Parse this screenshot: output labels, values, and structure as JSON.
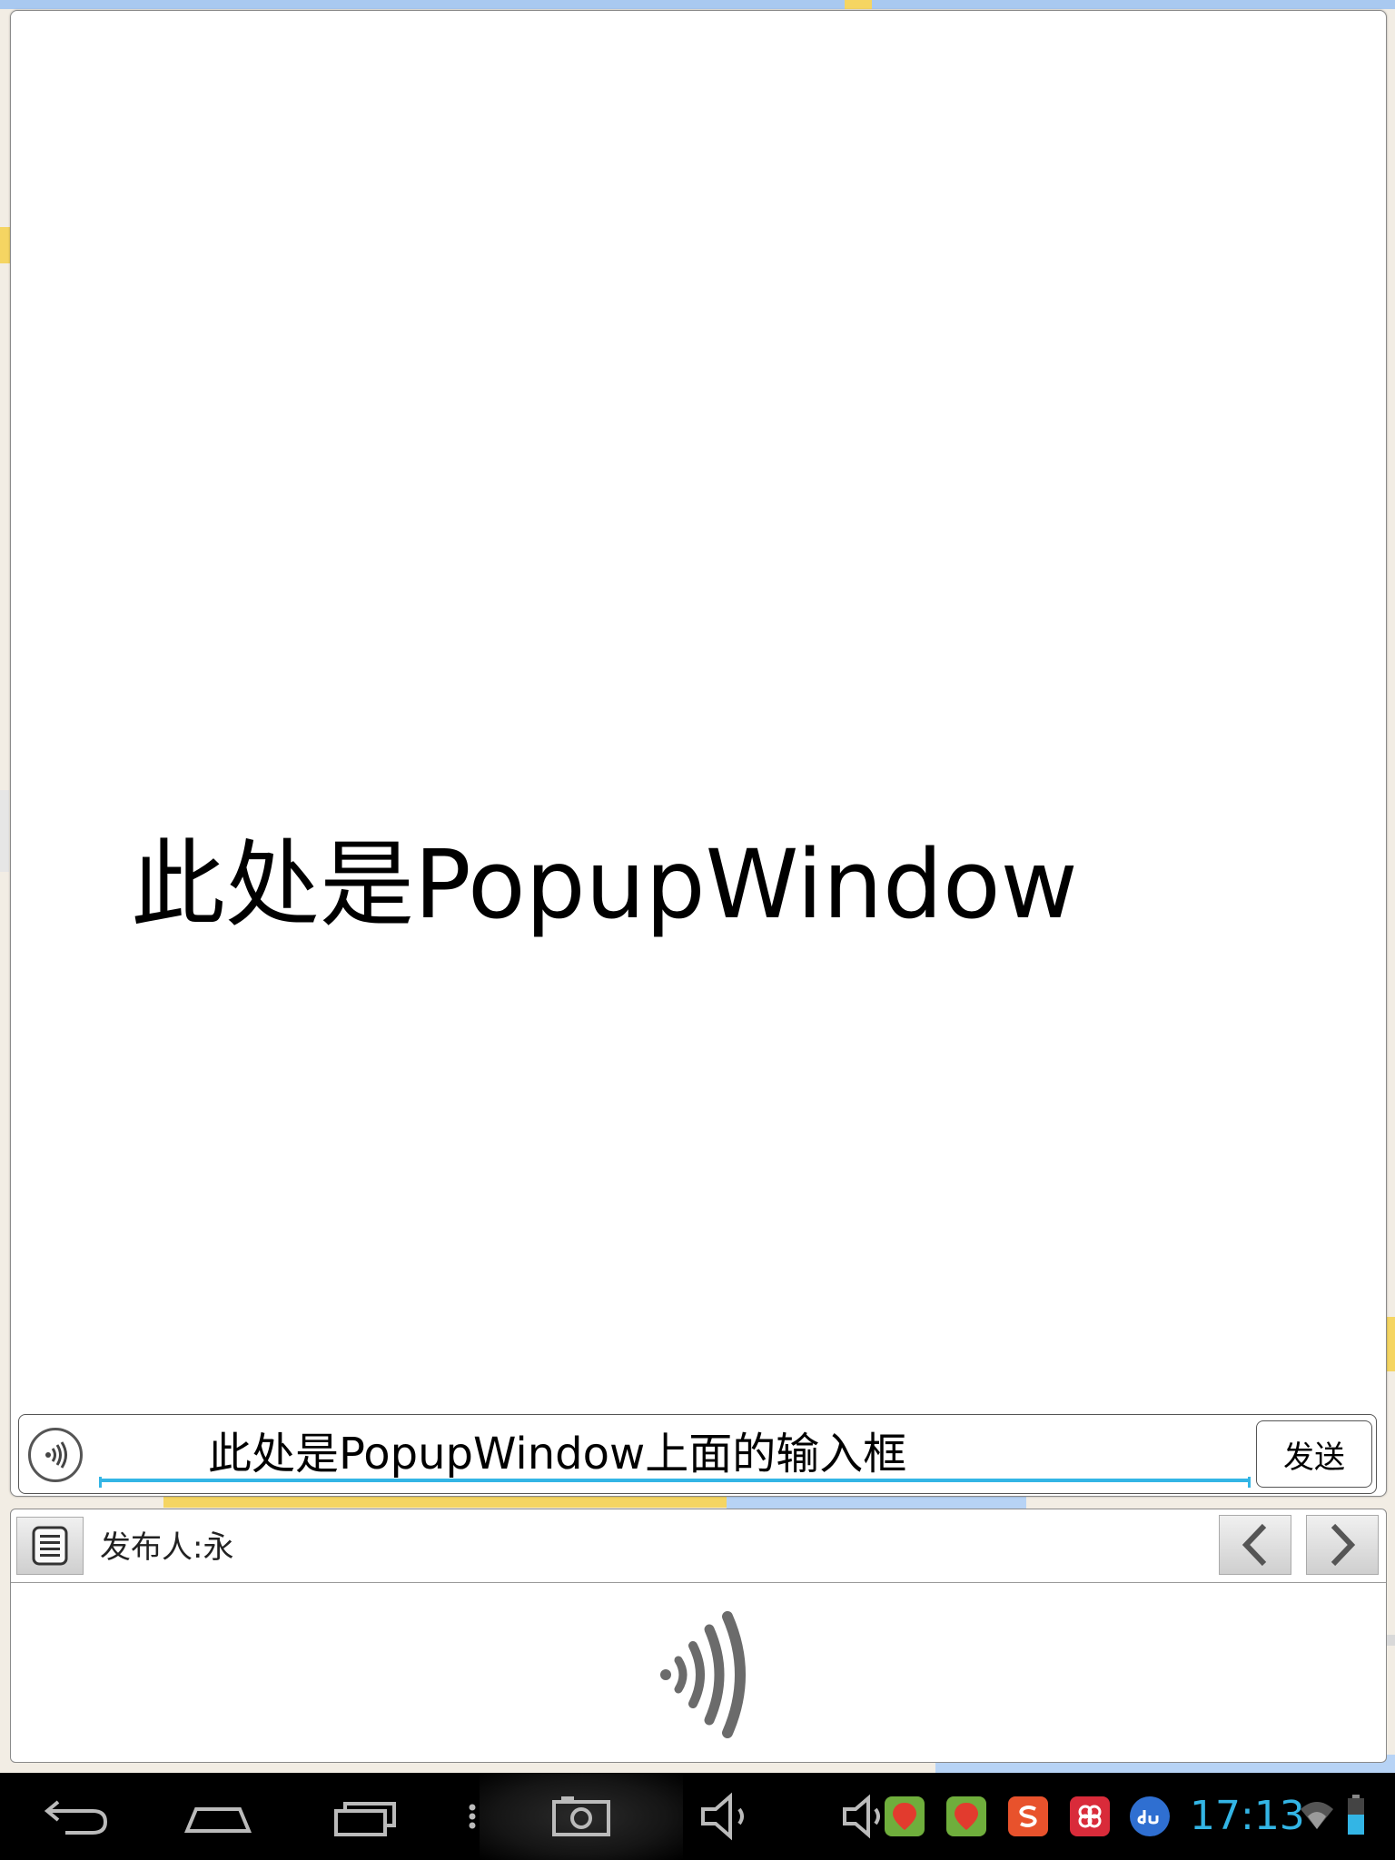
{
  "popup": {
    "main_text": "此处是PopupWindow",
    "input_value": "此处是PopupWindow上面的输入框",
    "send_label": "发送"
  },
  "panel": {
    "publisher": "发布人:永"
  },
  "system_bar": {
    "clock": "17:13"
  },
  "icons": [
    "back-icon",
    "home-icon",
    "recents-icon",
    "overflow-icon",
    "screenshot-icon",
    "volume-icon",
    "volume-app-icon",
    "baidu-map-icon",
    "baidu-map-icon-2",
    "sogou-icon",
    "pinwheel-app-icon",
    "du-icon",
    "wifi-icon",
    "battery-icon",
    "voice-icon",
    "menu-icon",
    "chevron-left-icon",
    "chevron-right-icon"
  ],
  "colors": {
    "accent": "#33b5e5",
    "map_bg": "#f2ede4",
    "road_yellow": "#f5d562"
  }
}
